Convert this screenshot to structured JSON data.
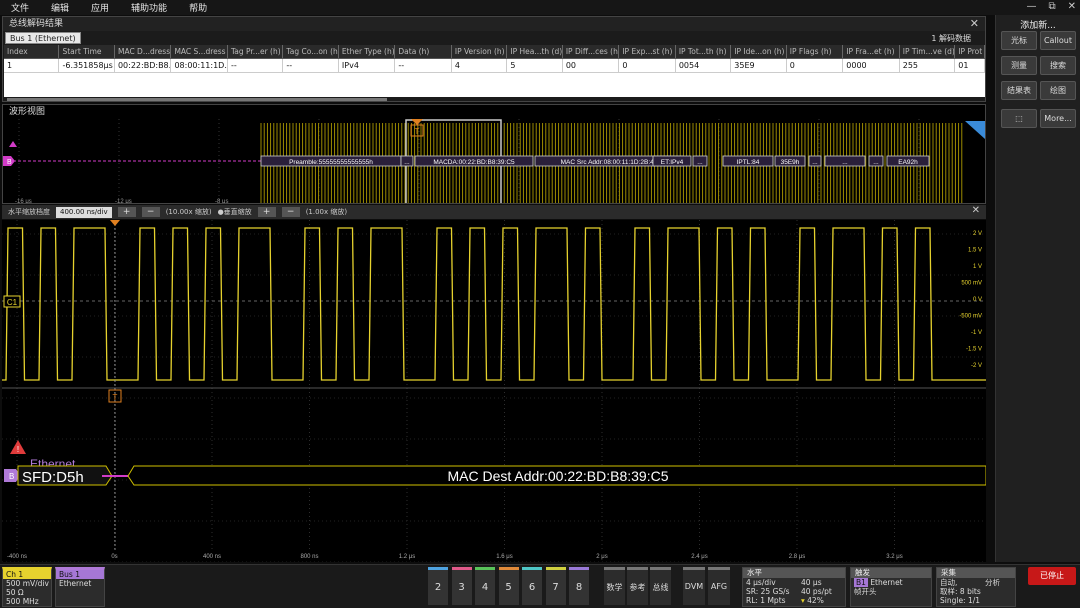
{
  "menu": [
    "文件",
    "编辑",
    "应用",
    "辅助功能",
    "帮助"
  ],
  "window_controls": [
    "—",
    "⧉",
    "✕"
  ],
  "decode": {
    "panel_title": "总线解码结果",
    "tab_label": "Bus 1 (Ethernet)",
    "result_count": "1 解码数据",
    "columns": [
      "Index",
      "Start Time",
      "MAC D...dress",
      "MAC S...dress",
      "Tag Pr...er (h)",
      "Tag Co...on (h)",
      "Ether Type (h)",
      "Data (h)",
      "IP Version (h)",
      "IP Hea...th (d)",
      "IP Diff...ces (h)",
      "IP Exp...st (h)",
      "IP Tot...th (h)",
      "IP Ide...on (h)",
      "IP Flags (h)",
      "IP Fra...et (h)",
      "IP Tim...ve (d)",
      "IP Prot"
    ],
    "rows": [
      [
        "1",
        "-6.351858μs",
        "00:22:BD:B8...",
        "08:00:11:1D...",
        "--",
        "--",
        "IPv4",
        "--",
        "4",
        "5",
        "00",
        "0",
        "0054",
        "35E9",
        "0",
        "0000",
        "255",
        "01"
      ]
    ]
  },
  "overview": {
    "panel_title": "波形视图",
    "bus_label": "B",
    "trigger_marker": "T",
    "packets": [
      "Preamble:55555555555555h",
      "...",
      "MACDA:00:22:BD:B8:39:C5",
      "MAC Src Addr:08:00:11:1D:2B:47",
      "ET:IPv4",
      "...",
      "IPTL:84",
      "35E9h",
      "...",
      "...",
      "...",
      "EA92h"
    ],
    "time_labels": [
      "-16 μs",
      "-12 μs",
      "-8 μs"
    ]
  },
  "zoom": {
    "h_label": "水平缩放档度",
    "h_value": "400.00 ns/div",
    "h_factor": "(10.00x 缩放)",
    "v_label": "●垂直缩放",
    "v_factor": "(1.00x 缩放)"
  },
  "display": {
    "ch_label": "C1",
    "v_ticks": [
      "2 V",
      "1.5 V",
      "1 V",
      "500 mV",
      "0 V",
      "-500 mV",
      "-1 V",
      "-1.5 V",
      "-2 V"
    ],
    "bus_protocol": "Ethernet",
    "bus_badge": "B",
    "sfd_text": "SFD:D5h",
    "mac_text": "MAC Dest Addr:00:22:BD:B8:39:C5",
    "trigger_marker": "T",
    "warning": "!",
    "time_ticks": [
      "-400 ns",
      "0s",
      "400 ns",
      "800 ns",
      "1.2 μs",
      "1.6 μs",
      "2 μs",
      "2.4 μs",
      "2.8 μs",
      "3.2 μs"
    ]
  },
  "sidebar": {
    "title": "添加新...",
    "buttons": [
      "光标",
      "Callout",
      "测量",
      "搜索",
      "结果表",
      "绘图",
      "",
      "More..."
    ]
  },
  "bottom": {
    "ch1": {
      "head": "Ch 1",
      "l1": "500 mV/div",
      "l2": "50 Ω",
      "l3": "500 MHz"
    },
    "bus1": {
      "head": "Bus 1",
      "l1": "Ethernet"
    },
    "channels": [
      "2",
      "3",
      "4",
      "5",
      "6",
      "7",
      "8"
    ],
    "modes": [
      "数学",
      "参考",
      "总线",
      "DVM",
      "AFG"
    ],
    "horizontal": {
      "head": "水平",
      "l1a": "4 μs/div",
      "l1b": "40 μs",
      "l2a": "SR: 25 GS/s",
      "l2b": "40 ps/pt",
      "l3a": "RL: 1 Mpts",
      "l3b": "42%"
    },
    "trigger": {
      "head": "触发",
      "l1a": "B1",
      "l1b": "Ethernet",
      "l2": "帧开头"
    },
    "acquisition": {
      "head": "采集",
      "l1a": "自动,",
      "l1b": "分析",
      "l2": "取样: 8 bits",
      "l3": "Single: 1/1"
    },
    "stop": "已停止"
  },
  "colors": {
    "ch1": "#e6d22e",
    "bus": "#d23cc8",
    "stop": "#c71818"
  }
}
